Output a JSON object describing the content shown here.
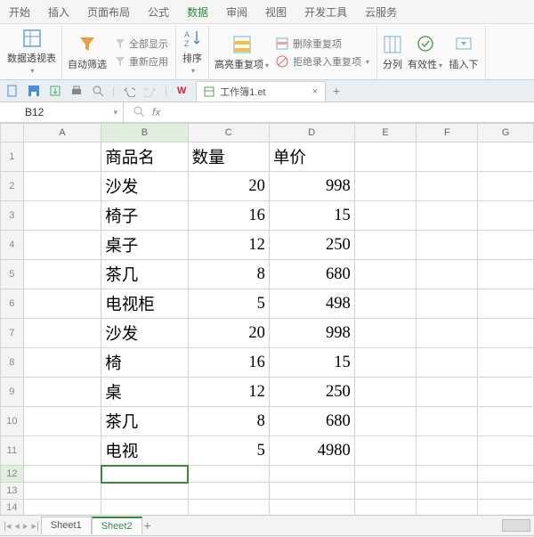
{
  "tabs": {
    "items": [
      "开始",
      "插入",
      "页面布局",
      "公式",
      "数据",
      "审阅",
      "视图",
      "开发工具",
      "云服务"
    ],
    "activeIndex": 4
  },
  "ribbon": {
    "pivot": "数据透视表",
    "autofilter": "自动筛选",
    "showall": "全部显示",
    "reapply": "重新应用",
    "sort": "排序",
    "highlight": "高亮重复项",
    "delDup": "删除重复项",
    "rejectDup": "拒绝录入重复项",
    "textToCols": "分列",
    "validation": "有效性",
    "insertDD": "插入下"
  },
  "docTab": {
    "title": "工作簿1.et"
  },
  "nameBox": "B12",
  "grid": {
    "cols": [
      "A",
      "B",
      "C",
      "D",
      "E",
      "F",
      "G"
    ],
    "rows": [
      1,
      2,
      3,
      4,
      5,
      6,
      7,
      8,
      9,
      10,
      11,
      12,
      13,
      14
    ],
    "selected": {
      "col": "B",
      "row": 12
    },
    "cells": {
      "1": {
        "B": "商品名",
        "C": "数量",
        "D": "单价"
      },
      "2": {
        "B": "沙发",
        "C": 20,
        "D": 998
      },
      "3": {
        "B": "椅子",
        "C": 16,
        "D": 15
      },
      "4": {
        "B": "桌子",
        "C": 12,
        "D": 250
      },
      "5": {
        "B": "茶几",
        "C": 8,
        "D": 680
      },
      "6": {
        "B": "电视柜",
        "C": 5,
        "D": 498
      },
      "7": {
        "B": "沙发",
        "C": 20,
        "D": 998
      },
      "8": {
        "B": "椅",
        "C": 16,
        "D": 15
      },
      "9": {
        "B": "桌",
        "C": 12,
        "D": 250
      },
      "10": {
        "B": "茶几",
        "C": 8,
        "D": 680
      },
      "11": {
        "B": "电视",
        "C": 5,
        "D": 4980
      }
    }
  },
  "sheets": {
    "items": [
      "Sheet1",
      "Sheet2"
    ],
    "activeIndex": 1
  }
}
